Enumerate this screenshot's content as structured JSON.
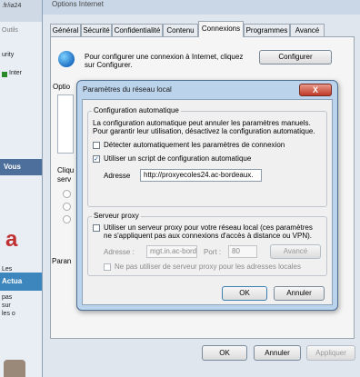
{
  "background": {
    "url_fragment": ".fr/ia24",
    "items": [
      "Outils",
      "urity",
      "Inter"
    ],
    "vous": "Vous",
    "red_glyph": "a",
    "actua": "Actua",
    "body_text": [
      "Les",
      "pas",
      "sur",
      "les o"
    ]
  },
  "options": {
    "title": "Options Internet",
    "tabs": [
      "Général",
      "Sécurité",
      "Confidentialité",
      "Contenu",
      "Connexions",
      "Programmes",
      "Avancé"
    ],
    "setup_text_1": "Pour configurer une connexion à Internet, cliquez",
    "setup_text_2": "sur Configurer.",
    "configure_button": "Configurer",
    "left_labels": [
      "Optio",
      "Cliqu",
      "serv",
      "Paran"
    ],
    "ok_button": "OK",
    "cancel_button": "Annuler",
    "apply_button": "Appliquer"
  },
  "lan": {
    "title": "Paramètres du réseau local",
    "close_glyph": "X",
    "auto_group": "Configuration automatique",
    "auto_desc_1": "La configuration automatique peut annuler les paramètres manuels.",
    "auto_desc_2": "Pour garantir leur utilisation, désactivez la configuration automatique.",
    "detect_label": "Détecter automatiquement les paramètres de connexion",
    "detect_checked": false,
    "script_label": "Utiliser un script de configuration automatique",
    "script_checked": true,
    "address_label": "Adresse",
    "address_value": "http://proxyecoles24.ac-bordeaux.",
    "proxy_group": "Serveur proxy",
    "proxy_label_1": "Utiliser un serveur proxy pour votre réseau local (ces paramètres",
    "proxy_label_2": "ne s'appliquent pas aux connexions d'accès à distance ou VPN).",
    "proxy_checked": false,
    "proxy_address_label": "Adresse :",
    "proxy_address_value": "mgt.in.ac-borde",
    "port_label": "Port :",
    "port_value": "80",
    "advanced_button": "Avancé",
    "bypass_label": "Ne pas utiliser de serveur proxy pour les adresses locales",
    "ok_button": "OK",
    "cancel_button": "Annuler",
    "check_glyph": "✓"
  }
}
